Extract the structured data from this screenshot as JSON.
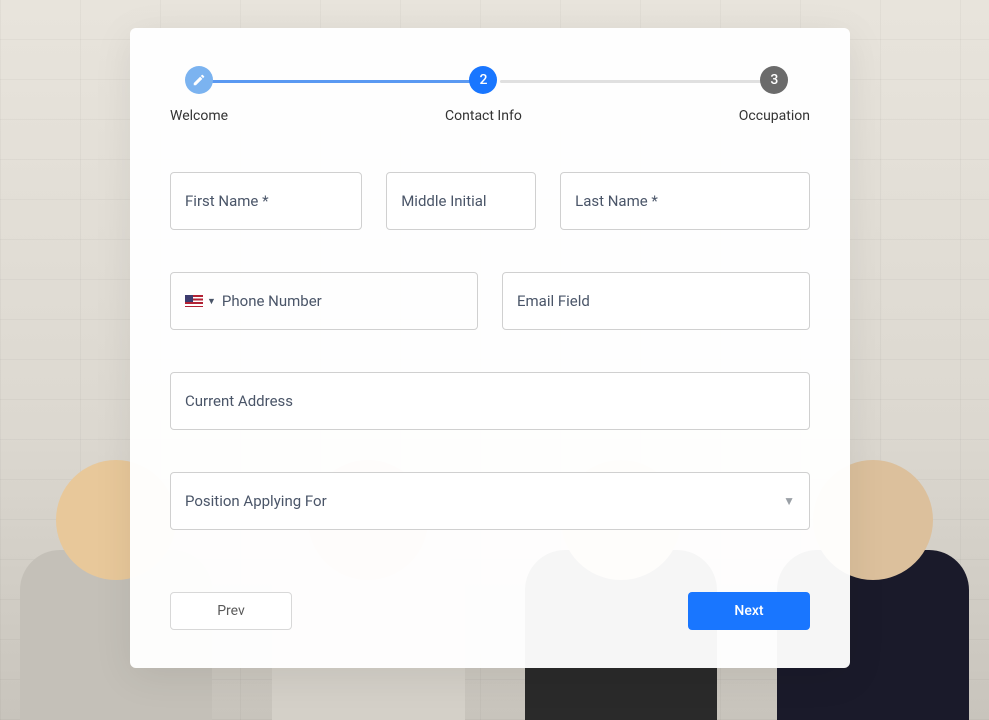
{
  "stepper": {
    "steps": [
      {
        "label": "Welcome",
        "state": "done"
      },
      {
        "label": "Contact Info",
        "number": "2",
        "state": "active"
      },
      {
        "label": "Occupation",
        "number": "3",
        "state": "pending"
      }
    ]
  },
  "form": {
    "first_name": {
      "placeholder": "First Name *",
      "value": ""
    },
    "middle_initial": {
      "placeholder": "Middle Initial",
      "value": ""
    },
    "last_name": {
      "placeholder": "Last Name *",
      "value": ""
    },
    "phone": {
      "placeholder": "Phone Number",
      "value": "",
      "country": "US"
    },
    "email": {
      "placeholder": "Email Field",
      "value": ""
    },
    "address": {
      "placeholder": "Current Address",
      "value": ""
    },
    "position": {
      "placeholder": "Position Applying For",
      "value": ""
    }
  },
  "actions": {
    "prev_label": "Prev",
    "next_label": "Next"
  }
}
